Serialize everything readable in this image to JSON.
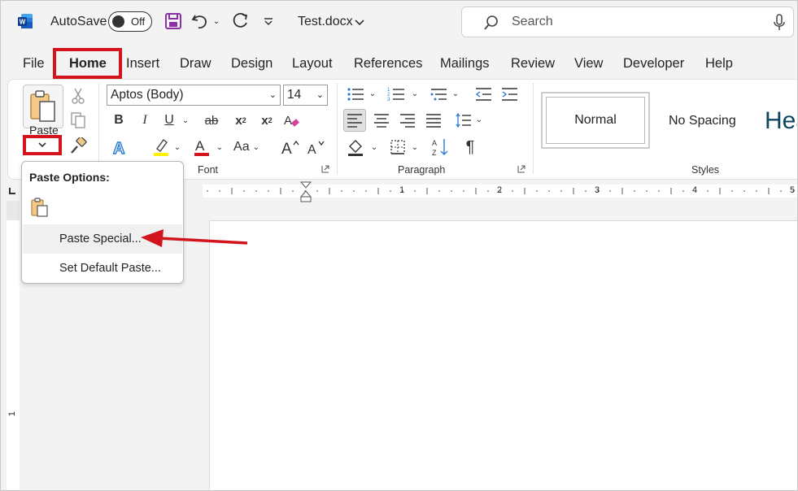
{
  "titlebar": {
    "autosave_label": "AutoSave",
    "autosave_state": "Off",
    "document_name": "Test.docx",
    "search_placeholder": "Search",
    "icons": [
      "word-logo-icon",
      "save-icon",
      "undo-icon",
      "redo-icon",
      "customize-icon",
      "search-icon",
      "microphone-icon"
    ]
  },
  "menu": {
    "tabs": [
      "File",
      "Home",
      "Insert",
      "Draw",
      "Design",
      "Layout",
      "References",
      "Mailings",
      "Review",
      "View",
      "Developer",
      "Help"
    ],
    "active": "Home"
  },
  "ribbon": {
    "clipboard": {
      "paste_label": "Paste"
    },
    "font": {
      "name": "Aptos (Body)",
      "size": "14",
      "bold": "B",
      "italic": "I",
      "underline": "U",
      "strike": "ab",
      "subscript": "x",
      "superscript": "x",
      "change_case": "Aa",
      "group_label": "Font"
    },
    "paragraph": {
      "group_label": "Paragraph"
    },
    "styles": {
      "items": [
        "Normal",
        "No Spacing",
        "Hea"
      ],
      "group_label": "Styles"
    }
  },
  "ruler": {
    "marks": [
      "1",
      "2",
      "3",
      "4",
      "5"
    ]
  },
  "paste_menu": {
    "header": "Paste Options:",
    "items": [
      "Paste Special...",
      "Set Default Paste..."
    ]
  },
  "colors": {
    "highlight_red": "#d2141c",
    "word_blue": "#185abd",
    "save_purple": "#8b2fa6"
  }
}
